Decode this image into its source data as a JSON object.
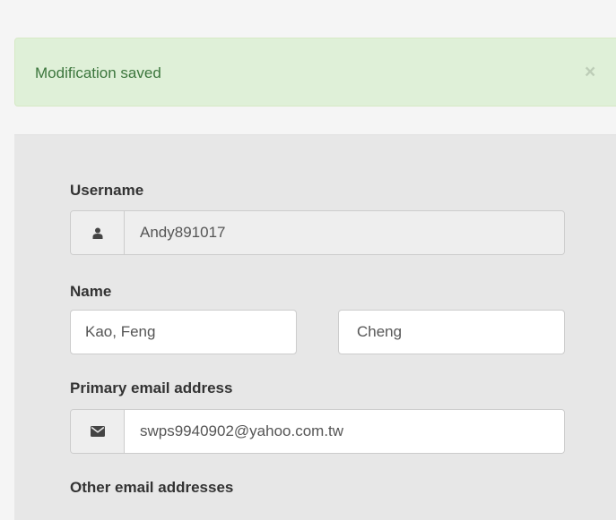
{
  "alert": {
    "message": "Modification saved",
    "close_symbol": "×",
    "background_color": "#dff0d8",
    "text_color": "#3c763d"
  },
  "form": {
    "username": {
      "label": "Username",
      "value": "Andy891017",
      "icon": "user-icon"
    },
    "name": {
      "label": "Name",
      "last_name": "Kao, Feng",
      "first_name": "Cheng"
    },
    "primary_email": {
      "label": "Primary email address",
      "value": "swps9940902@yahoo.com.tw",
      "icon": "envelope-icon"
    },
    "other_emails": {
      "label": "Other email addresses"
    }
  }
}
